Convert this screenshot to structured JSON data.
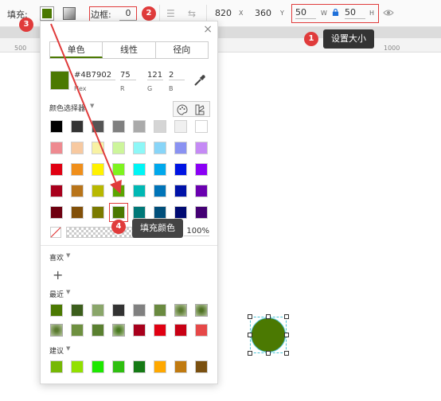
{
  "toolbar": {
    "fill_label": "填充:",
    "border_label": "边框:",
    "border_value": "0",
    "x_value": "820",
    "x_label": "X",
    "y_value": "360",
    "y_label": "Y",
    "w_value": "50",
    "w_label": "W",
    "h_value": "50",
    "h_label": "H"
  },
  "ruler": {
    "ticks": [
      "500",
      "1000"
    ]
  },
  "tooltips": {
    "set_size": "设置大小",
    "fill_color": "填充颜色"
  },
  "badges": {
    "b1": "1",
    "b2": "2",
    "b3": "3",
    "b4": "4"
  },
  "color_picker": {
    "tabs": [
      "单色",
      "线性",
      "径向"
    ],
    "hex": "#4B7902",
    "hex_label": "Hex",
    "r": "75",
    "g": "121",
    "b": "2",
    "r_label": "R",
    "g_label": "G",
    "b_label": "B",
    "selector_label": "颜色选择器",
    "alpha_value": "100%",
    "favorites_label": "喜欢",
    "recent_label": "最近",
    "suggest_label": "建议",
    "close": "×",
    "add": "+"
  },
  "palette_rows": [
    [
      "#000000",
      "#333333",
      "#555555",
      "#808080",
      "#aaaaaa",
      "#d5d5d5",
      "#f0f0f0",
      "#ffffff"
    ],
    [
      "#ee8a90",
      "#f7c9a0",
      "#f8f2a3",
      "#cdf59b",
      "#8df7f7",
      "#88d5f8",
      "#8a92f2",
      "#c58af5"
    ],
    [
      "#e00012",
      "#f08f1b",
      "#fff200",
      "#7ef31f",
      "#00f5f5",
      "#00a8ec",
      "#0014e3",
      "#8a00f5"
    ],
    [
      "#a8001c",
      "#b8741a",
      "#b8b800",
      "#5aa500",
      "#00b8b4",
      "#0074b8",
      "#0012a8",
      "#6a00b0"
    ],
    [
      "#6e0010",
      "#825009",
      "#7a7a00",
      "#4B7902",
      "#007878",
      "#004e7a",
      "#000a72",
      "#440074"
    ]
  ],
  "recent_rows": [
    [
      "#4B7902",
      "#3c5e1c",
      "#8aa66a",
      "#333333",
      "#808080",
      "#6a8a40",
      "#5a7a30",
      "#4f7224"
    ],
    [
      "#5a7a30",
      "#6e9040",
      "#5a8030",
      "#4a7a22",
      "#a8001c",
      "#e00012",
      "#c80014",
      "#e64848"
    ]
  ],
  "suggest_row": [
    "#76b805",
    "#92e000",
    "#1ee800",
    "#2fbf10",
    "#157a15",
    "#ffa800",
    "#c07a10",
    "#7a5010"
  ]
}
